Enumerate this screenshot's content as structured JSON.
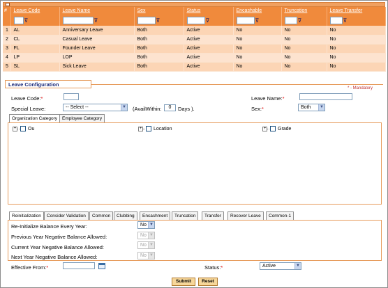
{
  "grid": {
    "hash": "#",
    "columns": [
      "Leave Code",
      "Leave Name",
      "Sex",
      "Status",
      "Encashable",
      "Truncation",
      "Leave Transfer"
    ],
    "rows": [
      {
        "num": "1",
        "code": "AL",
        "name": "Anniversary Leave",
        "sex": "Both",
        "status": "Active",
        "encashable": "No",
        "truncation": "No",
        "transfer": "No"
      },
      {
        "num": "2",
        "code": "CL",
        "name": "Casual Leave",
        "sex": "Both",
        "status": "Active",
        "encashable": "No",
        "truncation": "No",
        "transfer": "No"
      },
      {
        "num": "3",
        "code": "FL",
        "name": "Founder Leave",
        "sex": "Both",
        "status": "Active",
        "encashable": "No",
        "truncation": "No",
        "transfer": "No"
      },
      {
        "num": "4",
        "code": "LP",
        "name": "LOP",
        "sex": "Both",
        "status": "Active",
        "encashable": "No",
        "truncation": "No",
        "transfer": "No"
      },
      {
        "num": "5",
        "code": "SL",
        "name": "Sick Leave",
        "sex": "Both",
        "status": "Active",
        "encashable": "No",
        "truncation": "No",
        "transfer": "No"
      }
    ]
  },
  "config": {
    "title": "Leave Configuration",
    "mandatory_note": "* - Mandatory",
    "leave_code_label": "Leave Code:",
    "leave_name_label": "Leave Name:",
    "special_leave_label": "Special Leave:",
    "special_leave_value": "-- Select --",
    "avail_within_label": "(AvailWithin:",
    "avail_within_value": "0",
    "days_label": "Days ).",
    "sex_label": "Sex:",
    "sex_value": "Both"
  },
  "category_tabs": [
    "Organization Category",
    "Employee Category"
  ],
  "tree_items": [
    "Ou",
    "Location",
    "Grade"
  ],
  "bottom_tabs": [
    "Reinitialization",
    "Consider Validation",
    "Common",
    "Clubbing",
    "Encashment",
    "Truncation",
    "Transfer",
    "Recover Leave",
    "Common-1"
  ],
  "reinit": {
    "items": [
      {
        "label": "Re-Initialize Balance Every Year:",
        "value": "No"
      },
      {
        "label": "Previous Year Negative Balance Allowed:",
        "value": "No"
      },
      {
        "label": "Current Year Negative Balance Allowed:",
        "value": "No"
      },
      {
        "label": "Next Year Negative Balance Allowed:",
        "value": "No"
      }
    ]
  },
  "footer": {
    "effective_from_label": "Effective From:",
    "status_label": "Status:",
    "status_value": "Active",
    "submit_label": "Submit",
    "reset_label": "Reset"
  },
  "colors": {
    "header_orange": "#f08a3c",
    "row_light": "#fde3cf",
    "row_medium": "#fcd5b5",
    "border_orange": "#e69a5a",
    "title_blue": "#1a2a7a",
    "required_red": "#e00000",
    "button_tan": "#f7d79a"
  },
  "icons": [
    "filter-icon",
    "calendar-icon",
    "chevron-down-icon",
    "expand-plus-icon",
    "checkbox-icon"
  ]
}
